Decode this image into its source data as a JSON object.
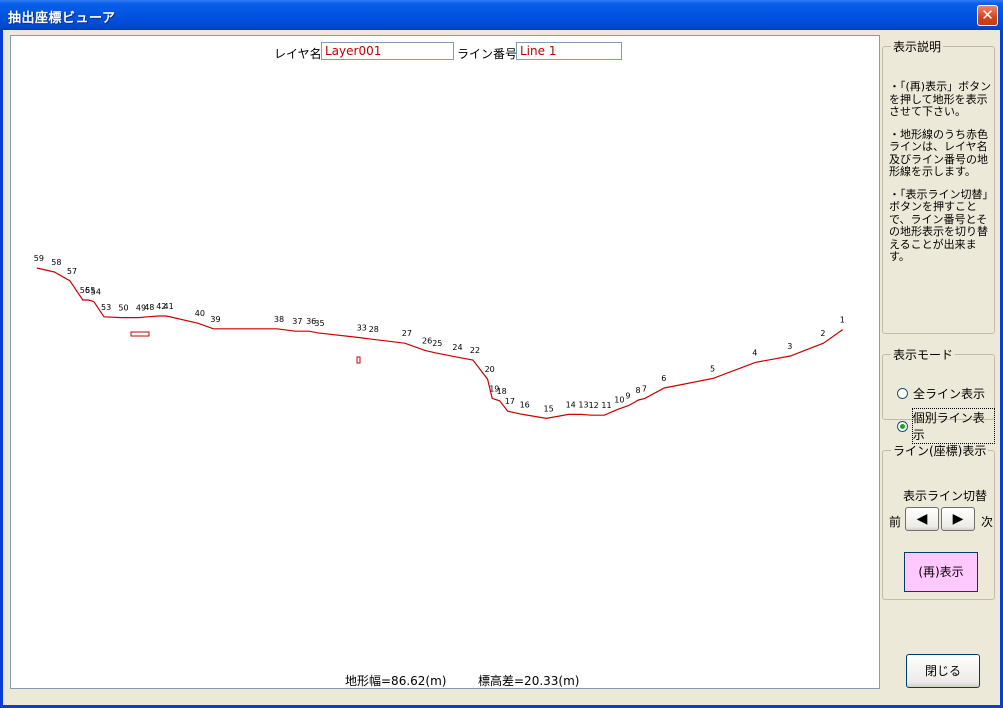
{
  "window": {
    "title": "抽出座標ビューア",
    "close_glyph": "✕"
  },
  "header": {
    "layer_label": "レイヤ名:",
    "layer_value": "Layer001",
    "line_label": "ライン番号:",
    "line_value": "Line 1"
  },
  "summary": {
    "width_text": "地形幅=86.62(m)",
    "height_text": "標高差=20.33(m)"
  },
  "profile": {
    "color": "#cc0000",
    "points": [
      {
        "label": "59",
        "x": -1.0,
        "y": 10.5
      },
      {
        "label": "58",
        "x": 0.9,
        "y": 10.0
      },
      {
        "label": "57",
        "x": 2.6,
        "y": 8.9
      },
      {
        "label": "56",
        "x": 4.0,
        "y": 6.5
      },
      {
        "label": "55",
        "x": 4.6,
        "y": 6.5
      },
      {
        "label": "54",
        "x": 5.2,
        "y": 6.3
      },
      {
        "label": "53",
        "x": 6.3,
        "y": 4.4
      },
      {
        "label": "50",
        "x": 8.2,
        "y": 4.3
      },
      {
        "label": "49",
        "x": 10.1,
        "y": 4.3
      },
      {
        "label": "48",
        "x": 11.0,
        "y": 4.4
      },
      {
        "label": "42",
        "x": 12.3,
        "y": 4.5
      },
      {
        "label": "41",
        "x": 13.1,
        "y": 4.5
      },
      {
        "label": "40",
        "x": 16.5,
        "y": 3.6
      },
      {
        "label": "39",
        "x": 18.2,
        "y": 2.9
      },
      {
        "label": "38",
        "x": 25.1,
        "y": 2.9
      },
      {
        "label": "37",
        "x": 27.1,
        "y": 2.6
      },
      {
        "label": "36",
        "x": 28.6,
        "y": 2.6
      },
      {
        "label": "35",
        "x": 29.5,
        "y": 2.4
      },
      {
        "label": "33",
        "x": 34.1,
        "y": 1.8
      },
      {
        "label": "28",
        "x": 35.4,
        "y": 1.6
      },
      {
        "label": "27",
        "x": 39.0,
        "y": 1.1
      },
      {
        "label": "26",
        "x": 41.2,
        "y": 0.2
      },
      {
        "label": "25",
        "x": 42.3,
        "y": -0.1
      },
      {
        "label": "24",
        "x": 44.5,
        "y": -0.6
      },
      {
        "label": "22",
        "x": 46.4,
        "y": -1.0
      },
      {
        "label": "20",
        "x": 48.0,
        "y": -3.4
      },
      {
        "label": "19",
        "x": 48.5,
        "y": -5.8
      },
      {
        "label": "18",
        "x": 49.3,
        "y": -6.1
      },
      {
        "label": "17",
        "x": 50.2,
        "y": -7.4
      },
      {
        "label": "16",
        "x": 51.8,
        "y": -7.8
      },
      {
        "label": "15",
        "x": 54.4,
        "y": -8.3
      },
      {
        "label": "14",
        "x": 56.8,
        "y": -7.8
      },
      {
        "label": "13",
        "x": 58.2,
        "y": -7.8
      },
      {
        "label": "12",
        "x": 59.3,
        "y": -7.9
      },
      {
        "label": "11",
        "x": 60.7,
        "y": -7.9
      },
      {
        "label": "10",
        "x": 62.1,
        "y": -7.2
      },
      {
        "label": "9",
        "x": 63.3,
        "y": -6.7
      },
      {
        "label": "8",
        "x": 64.4,
        "y": -6.0
      },
      {
        "label": "7",
        "x": 65.1,
        "y": -5.8
      },
      {
        "label": "6",
        "x": 67.2,
        "y": -4.5
      },
      {
        "label": "5",
        "x": 72.5,
        "y": -3.3
      },
      {
        "label": "4",
        "x": 77.1,
        "y": -1.3
      },
      {
        "label": "3",
        "x": 80.9,
        "y": -0.5
      },
      {
        "label": "2",
        "x": 84.5,
        "y": 1.1
      },
      {
        "label": "1",
        "x": 86.6,
        "y": 2.8
      }
    ]
  },
  "side": {
    "desc": {
      "legend": "表示説明",
      "p1": "・「(再)表示」ボタンを押して地形を表示させて下さい。",
      "p2": "・地形線のうち赤色ラインは、レイヤ名及びライン番号の地形線を示します。",
      "p3": "・「表示ライン切替」ボタンを押すことで、ライン番号とその地形表示を切り替えることが出来ます。"
    },
    "mode": {
      "legend": "表示モード",
      "option_all": "全ライン表示",
      "option_single": "個別ライン表示",
      "selected": "single"
    },
    "line": {
      "legend": "ライン(座標)表示",
      "switch_label": "表示ライン切替",
      "prev_label": "前",
      "next_label": "次",
      "prev_arrow": "◀",
      "next_arrow": "▶",
      "redisplay": "(再)表示"
    },
    "close_button": "閉じる"
  }
}
